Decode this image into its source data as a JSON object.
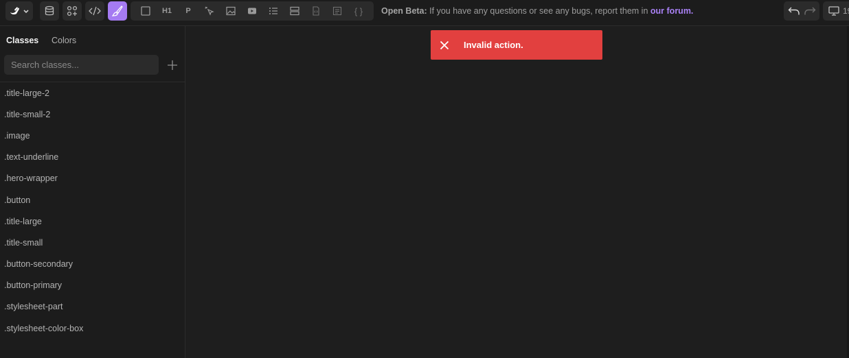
{
  "toolbar": {
    "icons": {
      "logo": "logo-icon",
      "chevron": "chevron-down-icon",
      "database": "database-icon",
      "components": "components-icon",
      "code": "code-icon",
      "style": "brush-icon"
    },
    "elements": {
      "heading": "H1",
      "paragraph": "P",
      "code_block": "{ }"
    },
    "beta_notice": {
      "label": "Open Beta:",
      "text": "If you have any questions or see any bugs, report them in",
      "link": "our forum."
    },
    "device_label": "19"
  },
  "sidebar": {
    "tabs": [
      "Classes",
      "Colors"
    ],
    "active_tab": "Classes",
    "search": {
      "placeholder": "Search classes...",
      "value": ""
    },
    "classes": [
      ".title-large-2",
      ".title-small-2",
      ".image",
      ".text-underline",
      ".hero-wrapper",
      ".button",
      ".title-large",
      ".title-small",
      ".button-secondary",
      ".button-primary",
      ".stylesheet-part",
      ".stylesheet-color-box"
    ]
  },
  "toast": {
    "message": "Invalid action.",
    "type": "error"
  },
  "colors": {
    "accent": "#a57bf2",
    "link": "#a981f5",
    "error": "#e2403f",
    "background": "#1e1e1e",
    "panel": "#1c1c1c"
  }
}
